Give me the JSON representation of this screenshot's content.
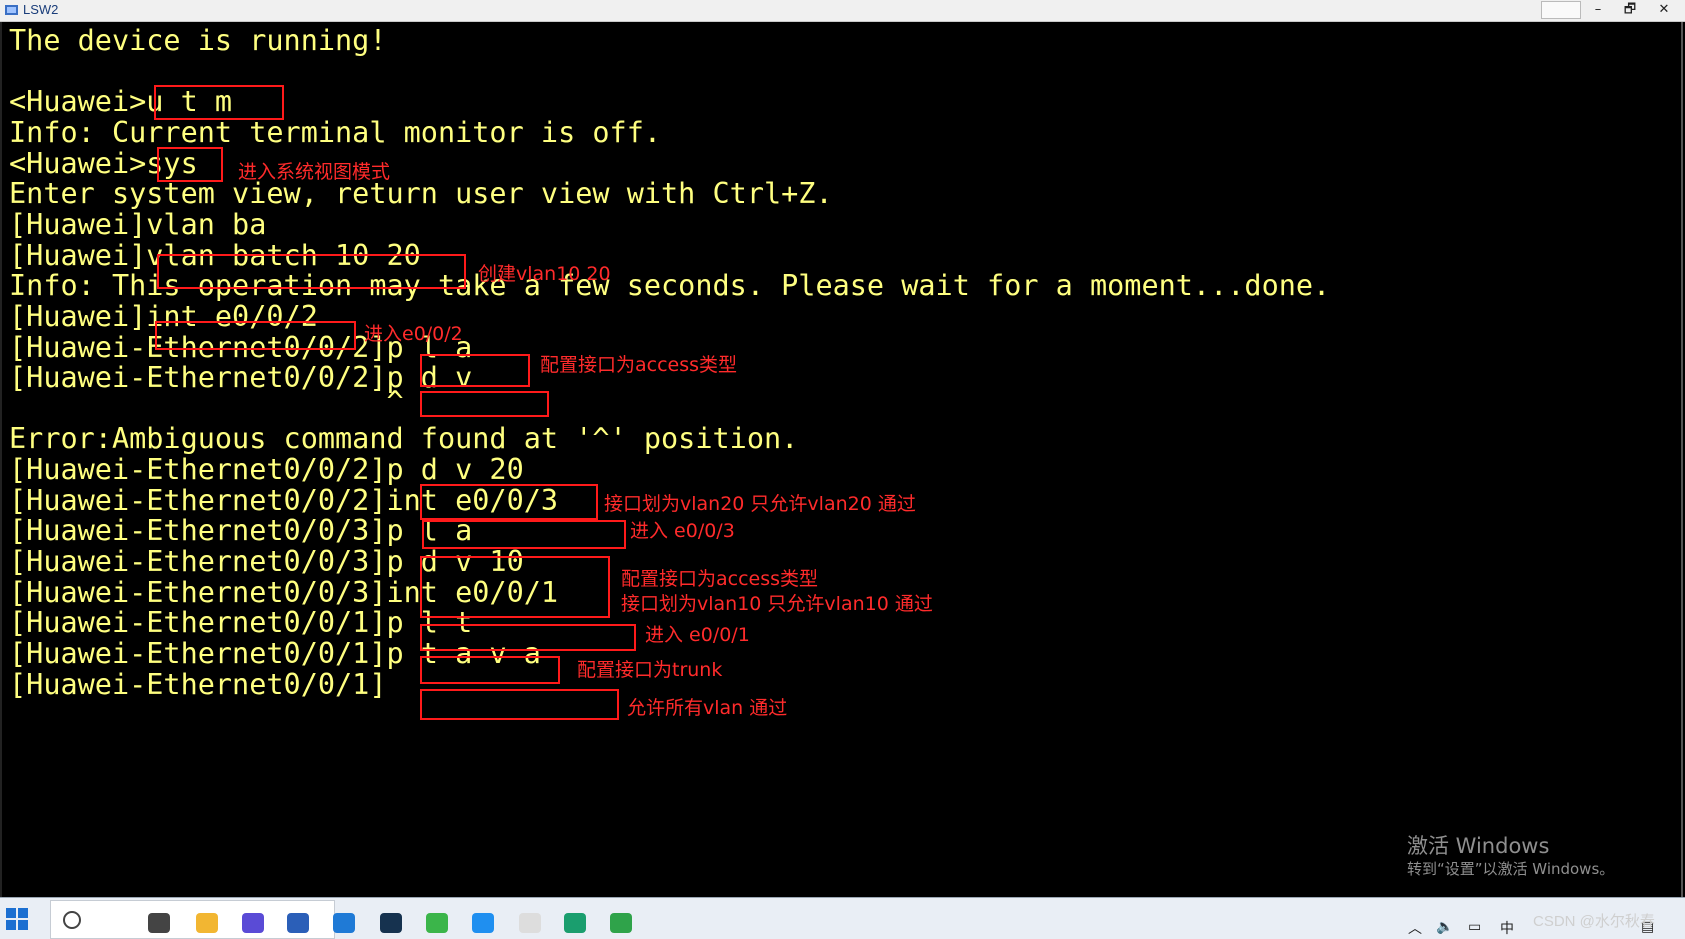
{
  "window": {
    "title": "LSW2",
    "controls": {
      "extra": "",
      "minimize": "–",
      "maximize": "🗗",
      "close": "✕"
    }
  },
  "terminal": {
    "lines": [
      "The device is running!",
      "",
      "<Huawei>u t m",
      "Info: Current terminal monitor is off.",
      "<Huawei>sys",
      "Enter system view, return user view with Ctrl+Z.",
      "[Huawei]vlan ba",
      "[Huawei]vlan batch 10 20",
      "Info: This operation may take a few seconds. Please wait for a moment...done.",
      "[Huawei]int e0/0/2",
      "[Huawei-Ethernet0/0/2]p l a",
      "[Huawei-Ethernet0/0/2]p d v",
      "                      ^",
      "Error:Ambiguous command found at '^' position.",
      "[Huawei-Ethernet0/0/2]p d v 20",
      "[Huawei-Ethernet0/0/2]int e0/0/3",
      "[Huawei-Ethernet0/0/3]p l a",
      "[Huawei-Ethernet0/0/3]p d v 10",
      "[Huawei-Ethernet0/0/3]int e0/0/1",
      "[Huawei-Ethernet0/0/1]p l t",
      "[Huawei-Ethernet0/0/1]p t a v a",
      "[Huawei-Ethernet0/0/1]"
    ]
  },
  "annotations": {
    "sys": "进入系统视图模式",
    "vlan_batch": "创建vlan10 20",
    "int_e002": "进入e0/0/2",
    "pla_1": "配置接口为access类型",
    "pdv20": "接口划为vlan20 只允许vlan20 通过",
    "int_e003": "进入 e0/0/3",
    "pla_2": "配置接口为access类型",
    "pdv10": "接口划为vlan10 只允许vlan10 通过",
    "int_e001": "进入 e0/0/1",
    "plt": "配置接口为trunk",
    "ptava": "允许所有vlan 通过"
  },
  "watermark": {
    "line1": "激活 Windows",
    "line2": "转到“设置”以激活 Windows。"
  },
  "taskbar": {
    "search_placeholder": "",
    "overlay": "CSDN @水尔秋春"
  },
  "colors": {
    "terminal_bg": "#000000",
    "terminal_text": "#ffff80",
    "annotation": "#ff1a1a"
  }
}
